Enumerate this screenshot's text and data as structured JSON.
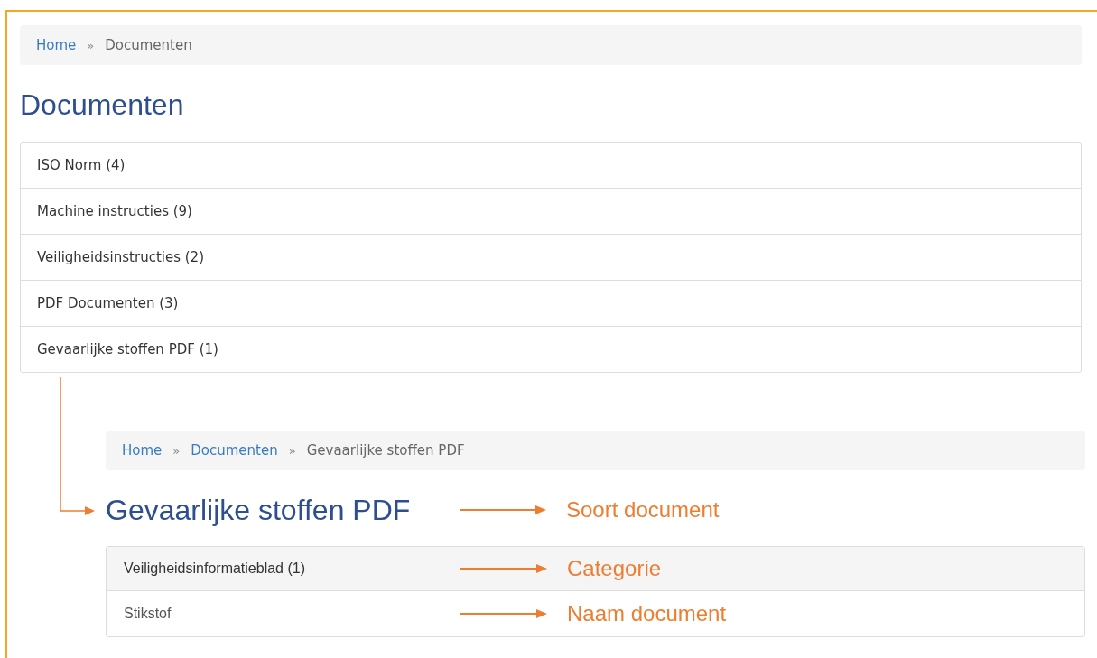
{
  "breadcrumb": [
    {
      "kind": "link",
      "label": "Home"
    },
    {
      "kind": "separator",
      "label": "»"
    },
    {
      "kind": "current",
      "label": "Documenten"
    }
  ],
  "title": "Documenten",
  "categories": [
    {
      "label": "ISO Norm (4)"
    },
    {
      "label": "Machine instructies (9)"
    },
    {
      "label": "Veiligheidsinstructies (2)"
    },
    {
      "label": "PDF Documenten (3)"
    },
    {
      "label": "Gevaarlijke stoffen PDF (1)"
    }
  ],
  "detail": {
    "breadcrumb": [
      {
        "kind": "link",
        "label": "Home"
      },
      {
        "kind": "separator",
        "label": "»"
      },
      {
        "kind": "link",
        "label": "Documenten"
      },
      {
        "kind": "separator",
        "label": "»"
      },
      {
        "kind": "current",
        "label": "Gevaarlijke stoffen PDF"
      }
    ],
    "title": {
      "text": "Gevaarlijke stoffen PDF",
      "annotation": "Soort document"
    },
    "panel": {
      "header": {
        "text": "Veiligheidsinformatieblad (1)",
        "annotation": "Categorie"
      },
      "items": [
        {
          "text": "Stikstof",
          "annotation": "Naam document"
        }
      ]
    }
  }
}
